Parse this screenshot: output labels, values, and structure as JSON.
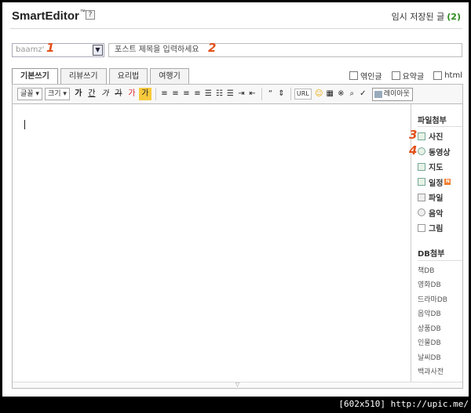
{
  "header": {
    "logo": "SmartEditor",
    "logo_tm": "™",
    "help": "?",
    "saved_label": "임시 저장된 글",
    "saved_count": "(2)"
  },
  "category": {
    "value": "baamz'",
    "arrow": "▼"
  },
  "title_input": {
    "placeholder": "포스트 제목을 입력하세요"
  },
  "annotations": [
    "1",
    "2",
    "3",
    "4"
  ],
  "tabs": [
    {
      "label": "기본쓰기",
      "active": true
    },
    {
      "label": "리뷰쓰기",
      "active": false
    },
    {
      "label": "요리법",
      "active": false
    },
    {
      "label": "여행기",
      "active": false
    }
  ],
  "options": [
    "엮인글",
    "요약글",
    "html"
  ],
  "toolbar": {
    "font": "글꼴 ▾",
    "size": "크기 ▾",
    "text_buttons": [
      "가",
      "간",
      "가",
      "가",
      "가",
      "가"
    ],
    "url": "URL",
    "layout": "레이아웃"
  },
  "sidebar": {
    "file_head": "파일첨부",
    "file_items": [
      "사진",
      "동영상",
      "지도",
      "일정",
      "파일",
      "음악",
      "그림"
    ],
    "new_badge": "N",
    "db_head": "DB첨부",
    "db_items": [
      "책DB",
      "영화DB",
      "드라마DB",
      "음악DB",
      "상품DB",
      "인물DB",
      "날씨DB",
      "백과사전"
    ]
  },
  "footer": "[602x510] http://upic.me/",
  "colors": {
    "accent": "#2a8a1a",
    "annotation": "#e3501a"
  }
}
